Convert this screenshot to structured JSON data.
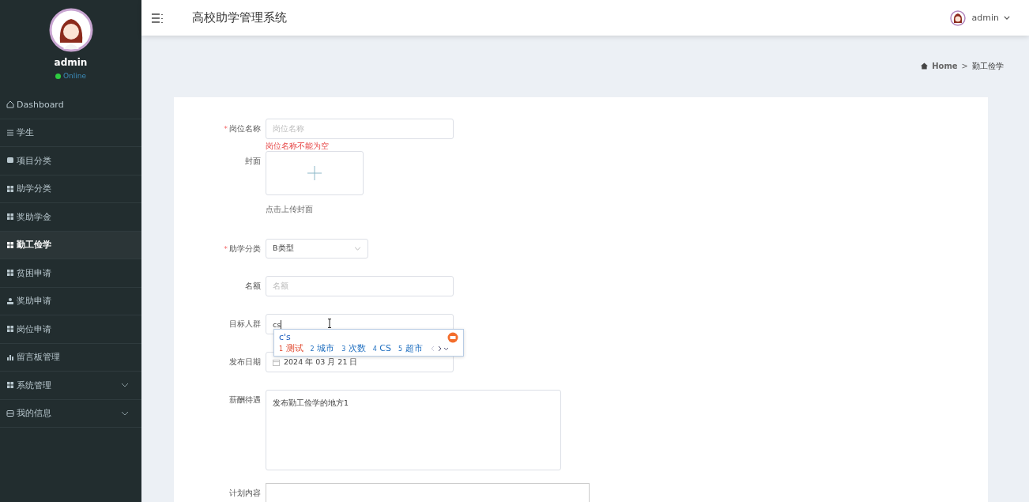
{
  "sidebar": {
    "user": {
      "name": "admin",
      "status": "Online"
    },
    "items": [
      {
        "label": "Dashboard",
        "selected": false,
        "expandable": false
      },
      {
        "label": "学生",
        "selected": false,
        "expandable": false
      },
      {
        "label": "项目分类",
        "selected": false,
        "expandable": false
      },
      {
        "label": "助学分类",
        "selected": false,
        "expandable": false
      },
      {
        "label": "奖助学金",
        "selected": false,
        "expandable": false
      },
      {
        "label": "勤工俭学",
        "selected": true,
        "expandable": false
      },
      {
        "label": "贫困申请",
        "selected": false,
        "expandable": false
      },
      {
        "label": "奖助申请",
        "selected": false,
        "expandable": false
      },
      {
        "label": "岗位申请",
        "selected": false,
        "expandable": false
      },
      {
        "label": "留言板管理",
        "selected": false,
        "expandable": false
      },
      {
        "label": "系统管理",
        "selected": false,
        "expandable": true
      },
      {
        "label": "我的信息",
        "selected": false,
        "expandable": true
      }
    ]
  },
  "header": {
    "title": "高校助学管理系统",
    "user": "admin"
  },
  "breadcrumb": {
    "items": [
      "Home",
      "勤工俭学"
    ],
    "separator": ">"
  },
  "form": {
    "fields": [
      {
        "kind": "input",
        "label": "岗位名称",
        "required_mark": "*",
        "placeholder": "岗位名称",
        "error": "岗位名称不能为空"
      },
      {
        "kind": "upload",
        "label": "封面",
        "hint": "点击上传封面"
      },
      {
        "kind": "select",
        "label": "助学分类",
        "required_mark": "*",
        "value": "B类型"
      },
      {
        "kind": "input",
        "label": "名额",
        "placeholder": "名额"
      },
      {
        "kind": "input",
        "label": "目标人群",
        "value": "cs"
      },
      {
        "kind": "date",
        "label": "发布日期",
        "value": "2024 年 03 月 21 日"
      },
      {
        "kind": "textarea",
        "label": "薪酬待遇",
        "value": "发布勤工俭学的地方1"
      },
      {
        "kind": "editor",
        "label": "计划内容"
      }
    ]
  },
  "ime": {
    "composition": "c's",
    "candidates": [
      {
        "number": "1",
        "text": "测试",
        "selected": true
      },
      {
        "number": "2",
        "text": "城市",
        "selected": false
      },
      {
        "number": "3",
        "text": "次数",
        "selected": false
      },
      {
        "number": "4",
        "text": "CS",
        "selected": false
      },
      {
        "number": "5",
        "text": "超市",
        "selected": false
      }
    ]
  }
}
